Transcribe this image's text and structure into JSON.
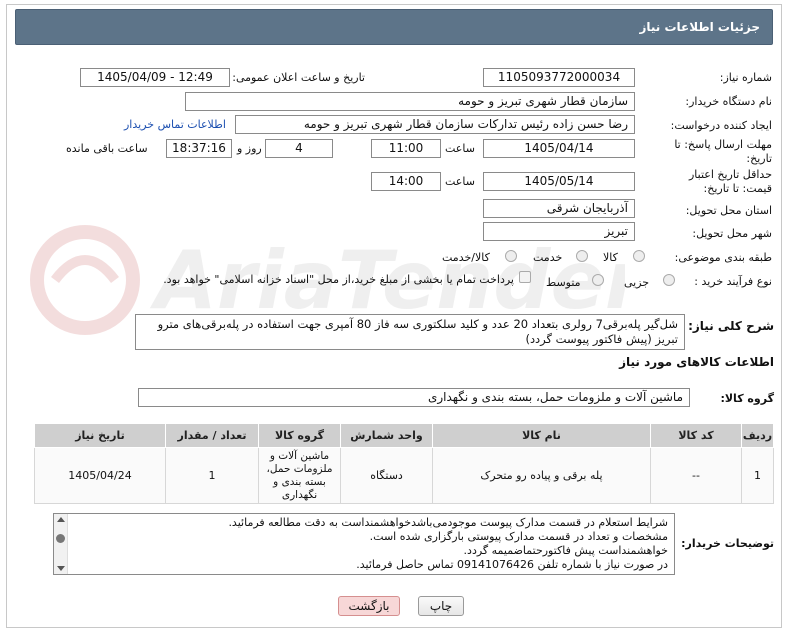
{
  "header": {
    "title": "جزئیات اطلاعات نیاز"
  },
  "fields": {
    "need_number_label": "شماره نیاز:",
    "need_number": "1105093772000034",
    "announce_datetime_label": "تاریخ و ساعت اعلان عمومی:",
    "announce_datetime": "1405/04/09 - 12:49",
    "buyer_org_label": "نام دستگاه خریدار:",
    "buyer_org": "سازمان قطار شهری تبریز و حومه",
    "requester_label": "ایجاد کننده درخواست:",
    "requester": "رضا حسن زاده رئیس تدارکات سازمان قطار شهری تبریز و حومه",
    "buyer_contact_link": "اطلاعات تماس خریدار",
    "reply_deadline_label": "مهلت ارسال پاسخ: تا تاریخ:",
    "reply_date": "1405/04/14",
    "time_label": "ساعت",
    "reply_time": "11:00",
    "days_value": "4",
    "days_label": "روز و",
    "remaining_time": "18:37:16",
    "remaining_label": "ساعت باقی مانده",
    "price_validity_label": "حداقل تاریخ اعتبار قیمت: تا تاریخ:",
    "price_validity_date": "1405/05/14",
    "price_time_label": "ساعت",
    "price_validity_time": "14:00",
    "delivery_province_label": "استان محل تحویل:",
    "delivery_province": "آذربایجان شرقی",
    "delivery_city_label": "شهر محل تحویل:",
    "delivery_city": "تبریز",
    "category_label": "طبقه بندی موضوعی:",
    "category_options": [
      "کالا",
      "خدمت",
      "کالا/خدمت"
    ],
    "purchase_type_label": "نوع فرآیند خرید :",
    "purchase_options": [
      "جزیی",
      "متوسط"
    ],
    "payment_note": "پرداخت تمام یا بخشی از مبلغ خرید،از محل \"اسناد خزانه اسلامی\" خواهد بود."
  },
  "description": {
    "label": "شرح کلی نیاز:",
    "text": "شل‌گیر پله‌برقی7 رولری بتعداد 20 عدد و کلید سلکتوری سه فاز 80 آمپری جهت استفاده در پله‌برقی‌های مترو تبریز (پیش فاکتور پیوست گردد)"
  },
  "goods_info_title": "اطلاعات کالاهای مورد نیاز",
  "goods_group": {
    "label": "گروه کالا:",
    "value": "ماشین آلات و ملزومات حمل، بسته بندی و نگهداری"
  },
  "table": {
    "headers": [
      "ردیف",
      "کد کالا",
      "نام کالا",
      "واحد شمارش",
      "گروه کالا",
      "تعداد / مقدار",
      "تاریخ نیاز"
    ],
    "rows": [
      {
        "index": "1",
        "code": "--",
        "name": "پله برقی و پیاده رو متحرک",
        "unit": "دستگاه",
        "group": "ماشین آلات و ملزومات حمل، بسته بندی و نگهداری",
        "qty": "1",
        "date": "1405/04/24"
      }
    ]
  },
  "buyer_notes": {
    "label": "توضیحات خریدار:",
    "lines": [
      "شرایط استعلام در قسمت مدارک پیوست موجودمی‌باشدخواهشمنداست به دقت مطالعه فرمائید.",
      "مشخصات و تعداد در قسمت مدارک پیوستی بارگزاری شده است.",
      "خواهشمنداست پیش فاکتورحتماضمیمه گردد.",
      "در صورت نیاز با شماره تلفن 09141076426 تماس حاصل فرمائید."
    ]
  },
  "buttons": {
    "print": "چاپ",
    "back": "بازگشت"
  }
}
